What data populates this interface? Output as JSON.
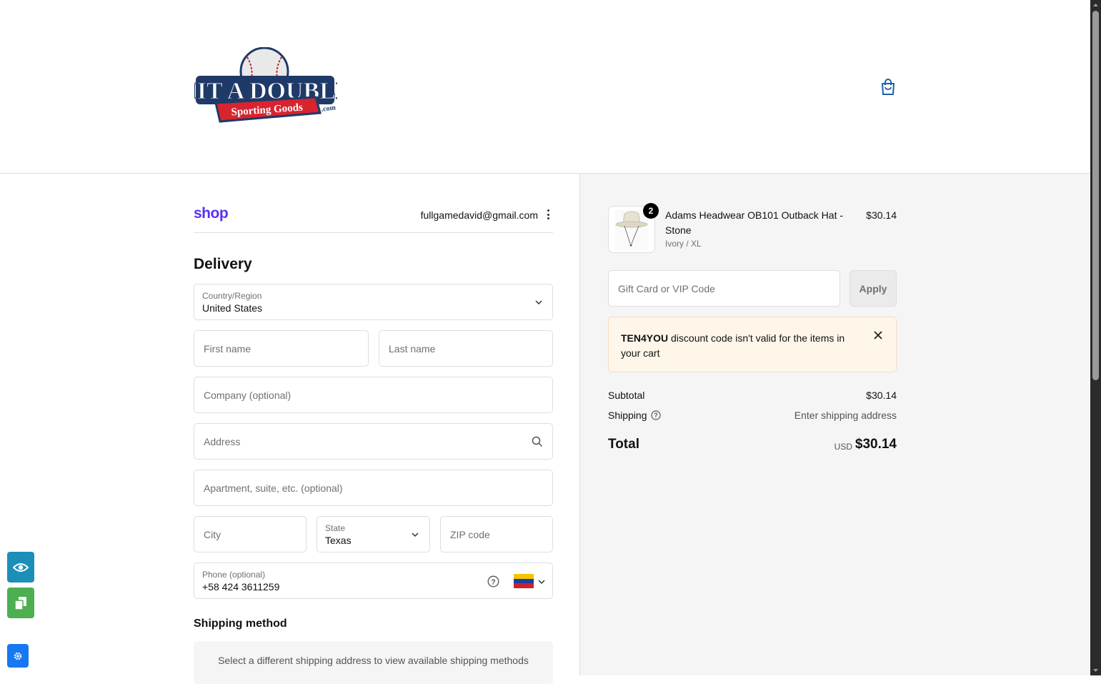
{
  "header": {
    "logo_text_top": "HIT A DOUBLE",
    "logo_text_banner": "Sporting Goods",
    "logo_text_suffix": ".com",
    "cart_icon": "shopping-bag-icon"
  },
  "account": {
    "shop_logo": "shop",
    "email": "fullgamedavid@gmail.com"
  },
  "delivery": {
    "heading": "Delivery",
    "country": {
      "label": "Country/Region",
      "value": "United States"
    },
    "first_name": {
      "placeholder": "First name",
      "value": ""
    },
    "last_name": {
      "placeholder": "Last name",
      "value": ""
    },
    "company": {
      "placeholder": "Company (optional)",
      "value": ""
    },
    "address": {
      "placeholder": "Address",
      "value": ""
    },
    "apartment": {
      "placeholder": "Apartment, suite, etc. (optional)",
      "value": ""
    },
    "city": {
      "placeholder": "City",
      "value": ""
    },
    "state": {
      "label": "State",
      "value": "Texas"
    },
    "zip": {
      "placeholder": "ZIP code",
      "value": ""
    },
    "phone": {
      "label": "Phone (optional)",
      "value": "+58 424 3611259",
      "flag": "venezuela-flag-icon"
    }
  },
  "shipping_method": {
    "heading": "Shipping method",
    "message": "Select a different shipping address to view available shipping methods"
  },
  "order": {
    "item": {
      "quantity": "2",
      "name": "Adams Headwear OB101 Outback Hat - Stone",
      "variant": "Ivory / XL",
      "price": "$30.14"
    },
    "discount": {
      "placeholder": "Gift Card or VIP Code",
      "value": "",
      "apply_label": "Apply"
    },
    "alert": {
      "code": "TEN4YOU",
      "message": " discount code isn't valid for the items in your cart"
    },
    "subtotal_label": "Subtotal",
    "subtotal_value": "$30.14",
    "shipping_label": "Shipping",
    "shipping_value": "Enter shipping address",
    "total_label": "Total",
    "total_currency": "USD",
    "total_value": "$30.14"
  },
  "colors": {
    "shop_brand": "#5a31f4",
    "alert_bg": "#fff6ea",
    "summary_bg": "#f5f5f5",
    "cart_icon": "#1d5fa8"
  }
}
